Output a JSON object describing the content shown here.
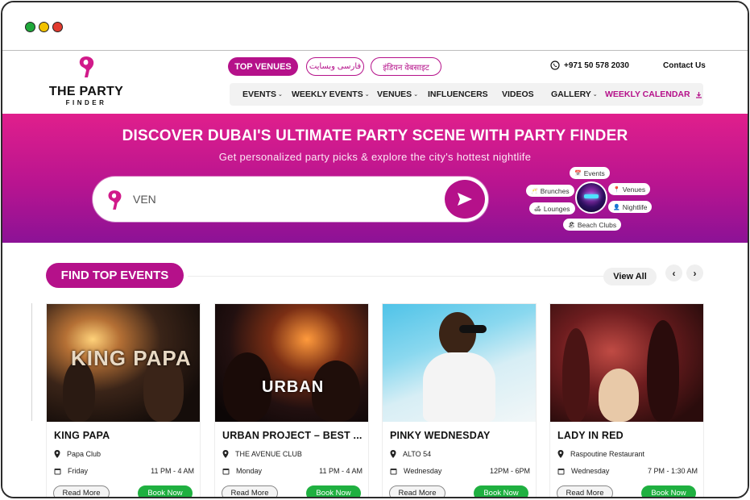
{
  "window": {
    "controls": [
      "green",
      "yellow",
      "red"
    ]
  },
  "header": {
    "logo": {
      "main": "THE PARTY",
      "sub": "FINDER"
    },
    "pills": {
      "top_venues": "TOP VENUES",
      "farsi": "فارسی وبسایت",
      "hindi": "इंडियन वेबसाइट"
    },
    "phone": "+971 50 578 2030",
    "contact": "Contact Us",
    "nav": [
      {
        "label": "EVENTS",
        "dropdown": true
      },
      {
        "label": "WEEKLY EVENTS",
        "dropdown": true
      },
      {
        "label": "VENUES",
        "dropdown": true
      },
      {
        "label": "INFLUENCERS",
        "dropdown": false
      },
      {
        "label": "VIDEOS",
        "dropdown": false
      },
      {
        "label": "GALLERY",
        "dropdown": true
      },
      {
        "label": "WEEKLY CALENDAR",
        "dropdown": false,
        "accent": true
      }
    ]
  },
  "hero": {
    "title": "DISCOVER DUBAI'S ULTIMATE PARTY SCENE WITH PARTY FINDER",
    "subtitle": "Get personalized party picks & explore the city's hottest nightlife",
    "search": {
      "value": "VEN"
    },
    "chips": {
      "events": "Events",
      "brunches": "Brunches",
      "venues": "Venues",
      "lounges": "Lounges",
      "nightlife": "Nightlife",
      "beach_clubs": "Beach Clubs"
    }
  },
  "section": {
    "title": "FIND TOP EVENTS",
    "view_all": "View All",
    "prev": "‹",
    "next": "›",
    "cards": [
      {
        "title": "KING PAPA",
        "venue": "Papa Club",
        "day": "Friday",
        "time": "11 PM - 4 AM",
        "read_more": "Read More",
        "book_now": "Book Now",
        "image_text": "KING PAPA"
      },
      {
        "title": "URBAN PROJECT – BEST ...",
        "venue": "THE AVENUE CLUB",
        "day": "Monday",
        "time": "11 PM - 4 AM",
        "read_more": "Read More",
        "book_now": "Book Now",
        "image_text": "URBAN"
      },
      {
        "title": "PINKY WEDNESDAY",
        "venue": "ALTO 54",
        "day": "Wednesday",
        "time": "12PM - 6PM",
        "read_more": "Read More",
        "book_now": "Book Now"
      },
      {
        "title": "LADY IN RED",
        "venue": "Raspoutine Restaurant",
        "day": "Wednesday",
        "time": "7 PM - 1:30 AM",
        "read_more": "Read More",
        "book_now": "Book Now"
      }
    ]
  },
  "colors": {
    "brand": "#b5118a",
    "hero_top": "#e01f8c",
    "hero_bottom": "#8c1296",
    "book": "#1fb040"
  }
}
